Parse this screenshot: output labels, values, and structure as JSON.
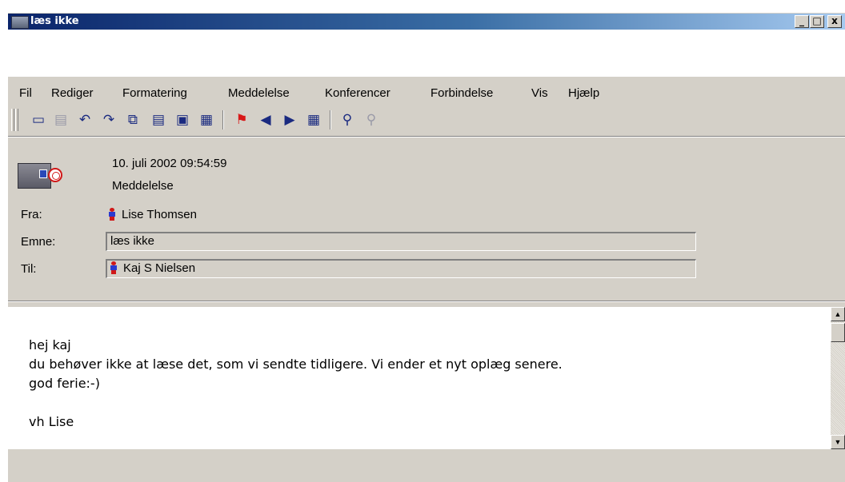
{
  "window": {
    "title": "læs ikke",
    "controls": {
      "minimize": "_",
      "maximize": "□",
      "close": "x"
    }
  },
  "menu": [
    "Fil",
    "Rediger",
    "Formatering",
    "Meddelelse",
    "Konferencer",
    "Forbindelse",
    "Vis",
    "Hjælp"
  ],
  "toolbar": {
    "icons": [
      "new-message-icon",
      "reply-icon",
      "reply-all-icon",
      "forward-icon",
      "copy-icon",
      "print-preview-icon",
      "print-icon",
      "delete-icon",
      "flag-icon",
      "previous-icon",
      "next-icon",
      "move-to-folder-icon",
      "find-icon",
      "find-next-icon"
    ]
  },
  "message": {
    "timestamp": "10. juli 2002 09:54:59",
    "type": "Meddelelse",
    "from_label": "Fra:",
    "from": "Lise Thomsen",
    "subject_label": "Emne:",
    "subject": "læs ikke",
    "to_label": "Til:",
    "to": "Kaj S Nielsen",
    "body": [
      "hej kaj",
      "du behøver ikke at læse det, som vi sendte tidligere. Vi ender et nyt oplæg senere.",
      "god ferie:-)",
      "",
      "vh Lise"
    ]
  },
  "colors": {
    "titlebar_start": "#0a246a",
    "titlebar_end": "#a6caf0",
    "window_bg": "#d4d0c8",
    "body_bg": "#ffffff"
  }
}
